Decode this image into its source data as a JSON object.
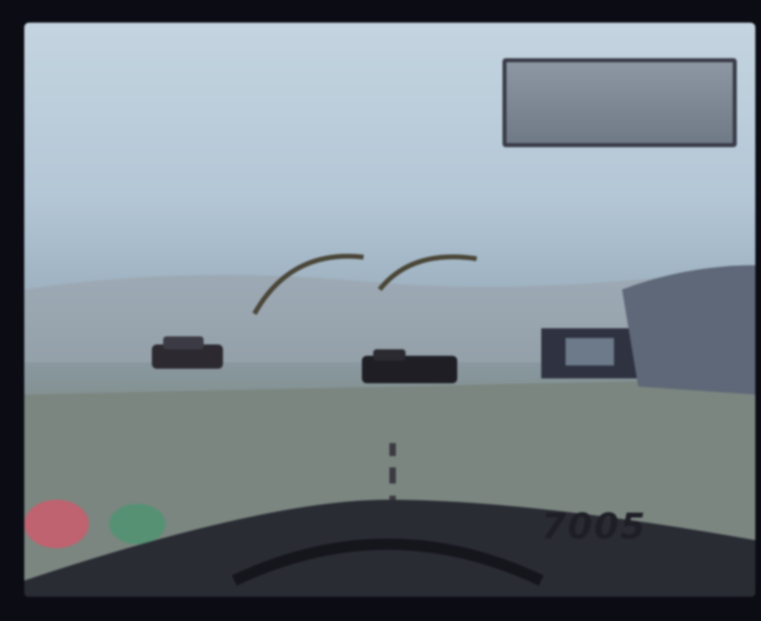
{
  "hud": {
    "top_left_text": "",
    "top_center_text": "",
    "odometer_text": "7005"
  },
  "colors": {
    "sky": "#c4d4e0",
    "road": "#7f8b85",
    "dashboard": "#2a2c34",
    "hud_frame": "#3a3c48"
  },
  "icons": [
    "car-icon",
    "car-icon",
    "steering-wheel-icon"
  ]
}
